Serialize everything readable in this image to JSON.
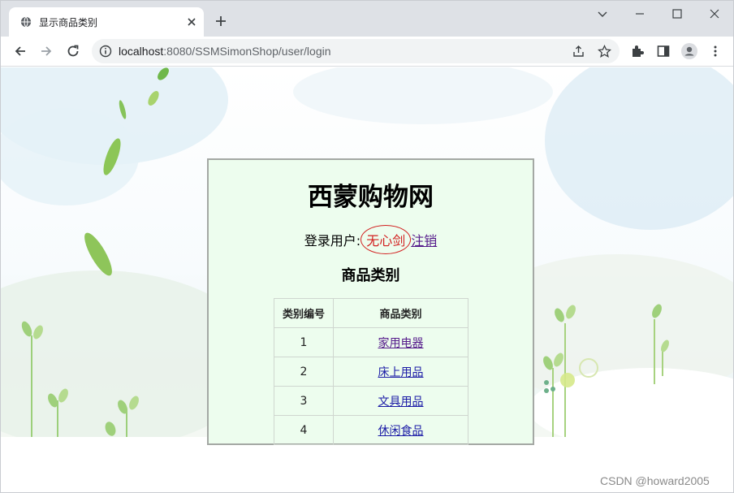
{
  "browser": {
    "tab_title": "显示商品类别",
    "url_host": "localhost",
    "url_rest": ":8080/SSMSimonShop/user/login"
  },
  "page": {
    "site_title": "西蒙购物网",
    "login_label": "登录用户:",
    "username": "无心剑",
    "logout_label": "注销",
    "section_title": "商品类别",
    "table": {
      "headers": [
        "类别编号",
        "商品类别"
      ],
      "rows": [
        {
          "id": "1",
          "name": "家用电器"
        },
        {
          "id": "2",
          "name": "床上用品"
        },
        {
          "id": "3",
          "name": "文具用品"
        },
        {
          "id": "4",
          "name": "休闲食品"
        }
      ]
    },
    "watermark": "CSDN @howard2005"
  },
  "colors": {
    "panel_bg": "#edfdee",
    "username": "#d21f1f",
    "link": "#1a1aa6",
    "visited_link": "#551a8b"
  },
  "icons": [
    "globe-icon",
    "close-icon",
    "plus-icon",
    "chevron-down-icon",
    "minimize-icon",
    "maximize-icon",
    "window-close-icon",
    "back-icon",
    "forward-icon",
    "reload-icon",
    "info-icon",
    "share-icon",
    "star-icon",
    "extensions-icon",
    "side-panel-icon",
    "profile-icon",
    "menu-icon"
  ]
}
